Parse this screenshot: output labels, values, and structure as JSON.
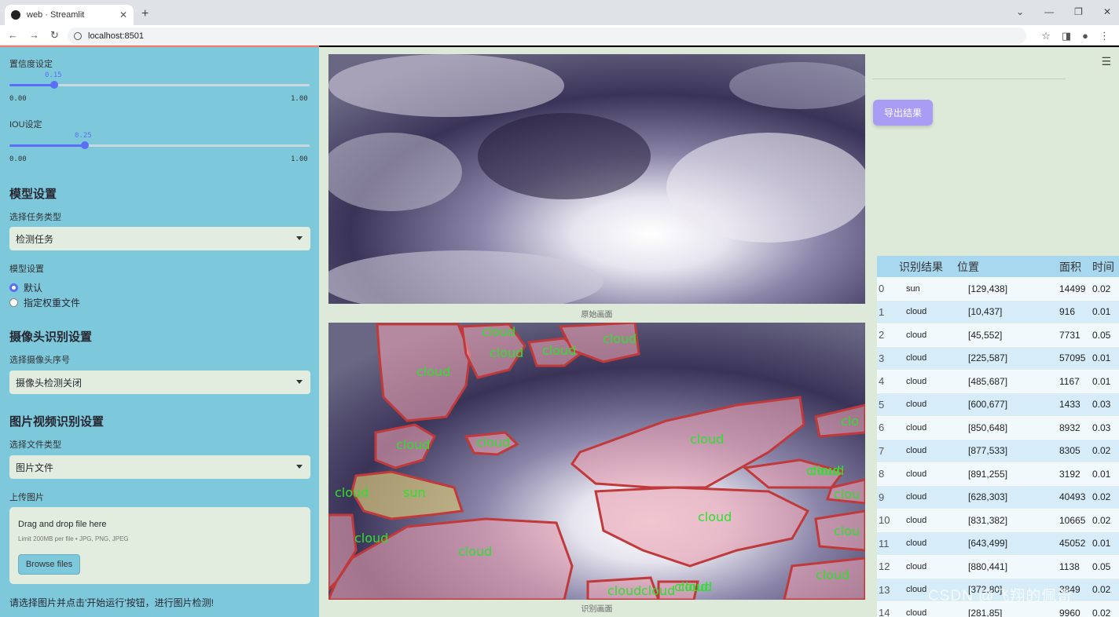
{
  "browser": {
    "tab_title": "web · Streamlit",
    "url": "localhost:8501"
  },
  "sidebar": {
    "confidence_label": "置信度设定",
    "confidence_value": "0.15",
    "confidence_fraction": 0.15,
    "iou_label": "IOU设定",
    "iou_value": "0.25",
    "iou_fraction": 0.25,
    "slider_min": "0.00",
    "slider_max": "1.00",
    "model_section": "模型设置",
    "task_label": "选择任务类型",
    "task_value": "检测任务",
    "model_label": "模型设置",
    "model_opt_default": "默认",
    "model_opt_custom": "指定权重文件",
    "camera_section": "摄像头识别设置",
    "camera_label": "选择摄像头序号",
    "camera_value": "摄像头检测关闭",
    "media_section": "图片视频识别设置",
    "filetype_label": "选择文件类型",
    "filetype_value": "图片文件",
    "upload_label": "上传图片",
    "drop_title": "Drag and drop file here",
    "drop_limit": "Limit 200MB per file • JPG, PNG, JPEG",
    "browse_label": "Browse files",
    "hint": "请选择图片并点击'开始运行'按钮，进行图片检测!"
  },
  "main": {
    "caption_original": "原始画面",
    "caption_result": "识别画面",
    "export_label": "导出结果"
  },
  "table": {
    "headers": [
      "识别结果",
      "位置",
      "面积",
      "时间"
    ],
    "rows": [
      [
        "0",
        "sun",
        "[129,438]",
        "14499",
        "0.02"
      ],
      [
        "1",
        "cloud",
        "[10,437]",
        "916",
        "0.01"
      ],
      [
        "2",
        "cloud",
        "[45,552]",
        "7731",
        "0.05"
      ],
      [
        "3",
        "cloud",
        "[225,587]",
        "57095",
        "0.01"
      ],
      [
        "4",
        "cloud",
        "[485,687]",
        "1167",
        "0.01"
      ],
      [
        "5",
        "cloud",
        "[600,677]",
        "1433",
        "0.03"
      ],
      [
        "6",
        "cloud",
        "[850,648]",
        "8932",
        "0.03"
      ],
      [
        "7",
        "cloud",
        "[877,533]",
        "8305",
        "0.02"
      ],
      [
        "8",
        "cloud",
        "[891,255]",
        "3192",
        "0.01"
      ],
      [
        "9",
        "cloud",
        "[628,303]",
        "40493",
        "0.02"
      ],
      [
        "10",
        "cloud",
        "[831,382]",
        "10665",
        "0.02"
      ],
      [
        "11",
        "cloud",
        "[643,499]",
        "45052",
        "0.01"
      ],
      [
        "12",
        "cloud",
        "[880,441]",
        "1138",
        "0.05"
      ],
      [
        "13",
        "cloud",
        "[372,80]",
        "3849",
        "0.02"
      ],
      [
        "14",
        "cloud",
        "[281,85]",
        "9960",
        "0.02"
      ]
    ]
  },
  "detection_labels": [
    "cloud",
    "cloud",
    "cloud",
    "cloud",
    "cloud",
    "cloud",
    "cloud",
    "cloud",
    "cloud",
    "cloud",
    "cloud",
    "sun",
    "cloud",
    "cloud",
    "cloud",
    "cloud",
    "clo",
    "cloud",
    "clou",
    "clou",
    "cloud",
    "cloud",
    "cloud"
  ],
  "watermark": "CSDN @飞翔的佩奇",
  "colors": {
    "sidebar": "#7ec8dc",
    "main_bg": "#dde9d9",
    "accent": "#5c6ef5",
    "detect_label": "#2ee02e",
    "detect_outline": "#c0393b"
  }
}
